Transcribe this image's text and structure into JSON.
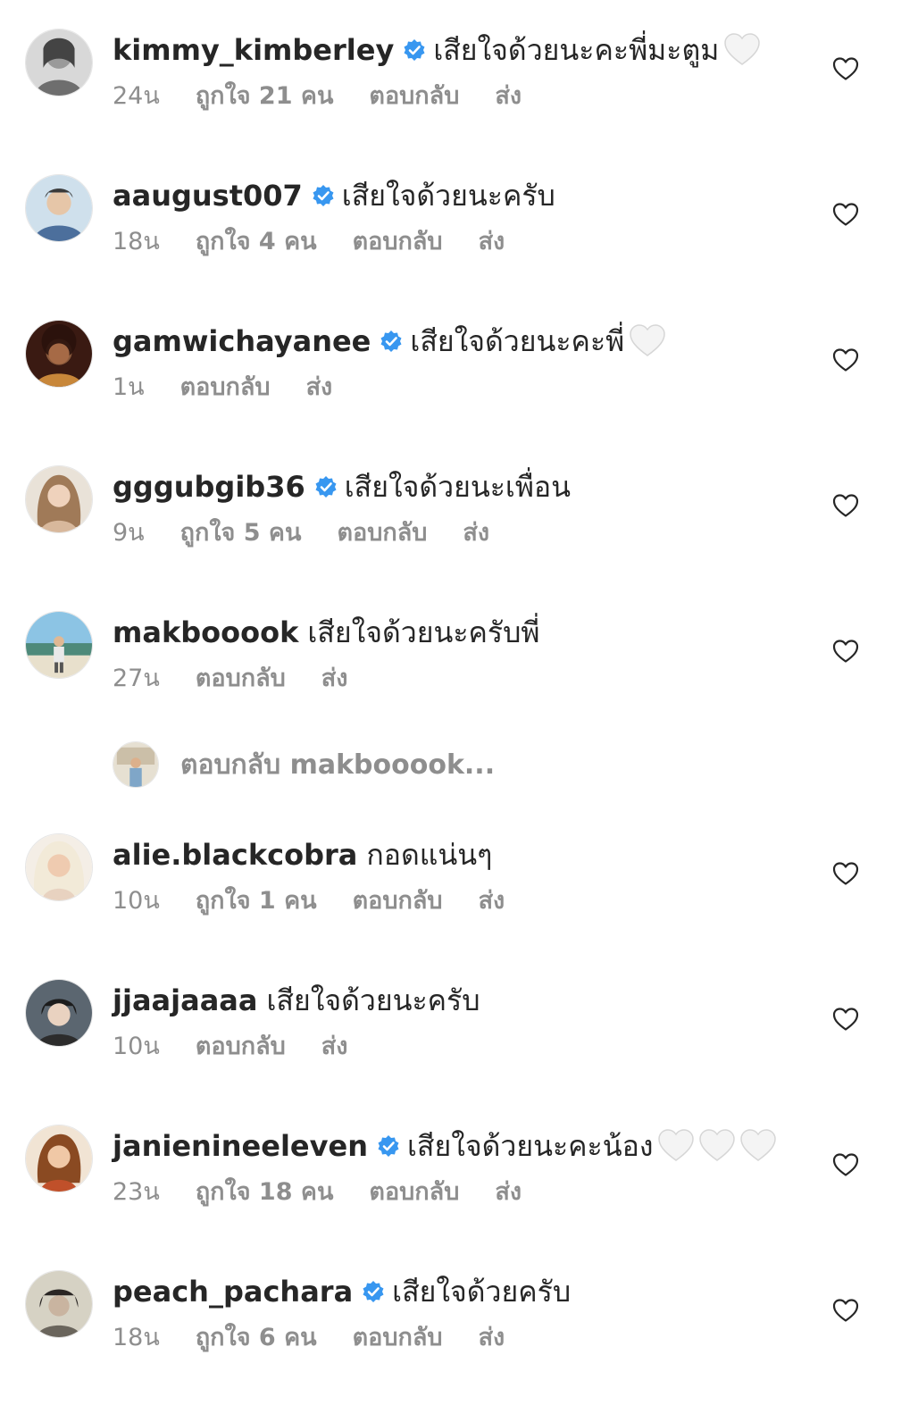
{
  "comments": [
    {
      "username": "kimmy_kimberley",
      "verified": true,
      "text": "เสียใจด้วยนะคะพี่มะตูม",
      "hearts": 1,
      "time": "24น",
      "likes": "ถูกใจ 21 คน",
      "reply": "ตอบกลับ",
      "send": "ส่ง",
      "avatar_color": "#9a9a9a"
    },
    {
      "username": "aaugust007",
      "verified": true,
      "text": "เสียใจด้วยนะครับ",
      "hearts": 0,
      "time": "18น",
      "likes": "ถูกใจ 4 คน",
      "reply": "ตอบกลับ",
      "send": "ส่ง",
      "avatar_color": "#6f8fb0"
    },
    {
      "username": "gamwichayanee",
      "verified": true,
      "text": "เสียใจด้วยนะคะพี่",
      "hearts": 1,
      "time": "1น",
      "likes": "",
      "reply": "ตอบกลับ",
      "send": "ส่ง",
      "avatar_color": "#5a2a1c"
    },
    {
      "username": "gggubgib36",
      "verified": true,
      "text": "เสียใจด้วยนะเพื่อน",
      "hearts": 0,
      "time": "9น",
      "likes": "ถูกใจ 5 คน",
      "reply": "ตอบกลับ",
      "send": "ส่ง",
      "avatar_color": "#b89a7c"
    },
    {
      "username": "makbooook",
      "verified": false,
      "text": "เสียใจด้วยนะครับพี่",
      "hearts": 0,
      "time": "27น",
      "likes": "",
      "reply": "ตอบกลับ",
      "send": "ส่ง",
      "avatar_color": "#7fb8d6"
    },
    {
      "username": "alie.blackcobra",
      "verified": false,
      "text": "กอดแน่นๆ",
      "hearts": 0,
      "time": "10น",
      "likes": "ถูกใจ 1 คน",
      "reply": "ตอบกลับ",
      "send": "ส่ง",
      "avatar_color": "#e8d6c2"
    },
    {
      "username": "jjaajaaaa",
      "verified": false,
      "text": "เสียใจด้วยนะครับ",
      "hearts": 0,
      "time": "10น",
      "likes": "",
      "reply": "ตอบกลับ",
      "send": "ส่ง",
      "avatar_color": "#4a5560"
    },
    {
      "username": "janienineeleven",
      "verified": true,
      "text": "เสียใจด้วยนะคะน้อง",
      "hearts": 3,
      "time": "23น",
      "likes": "ถูกใจ 18 คน",
      "reply": "ตอบกลับ",
      "send": "ส่ง",
      "avatar_color": "#c98a5a"
    },
    {
      "username": "peach_pachara",
      "verified": true,
      "text": "เสียใจด้วยครับ",
      "hearts": 0,
      "time": "18น",
      "likes": "ถูกใจ 6 คน",
      "reply": "ตอบกลับ",
      "send": "ส่ง",
      "avatar_color": "#8a8a7a"
    }
  ],
  "replies_link": {
    "label": "ตอบกลับ makbooook..."
  },
  "colors": {
    "verified_blue": "#3897f0",
    "secondary_text": "#8e8e8e",
    "primary_text": "#262626"
  }
}
